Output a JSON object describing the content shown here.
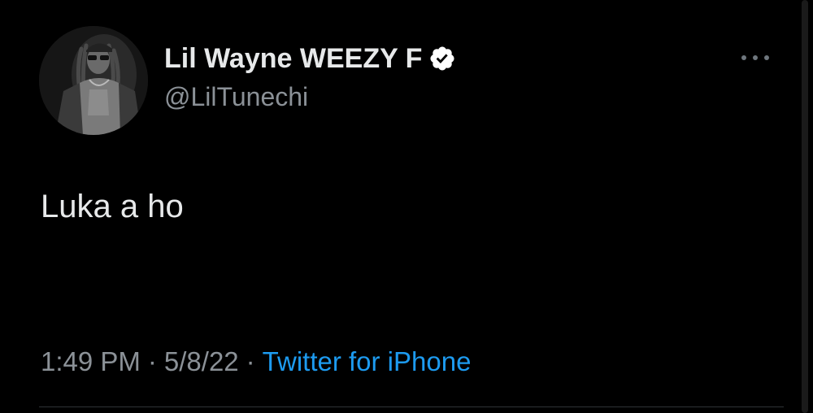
{
  "tweet": {
    "author": {
      "display_name": "Lil Wayne WEEZY F",
      "handle": "@LilTunechi",
      "verified": true,
      "avatar_icon": "profile-photo"
    },
    "text": "Luka a ho",
    "time": "1:49 PM",
    "date": "5/8/22",
    "separator": "·",
    "source": "Twitter for iPhone",
    "more_icon": "ellipsis-icon"
  },
  "colors": {
    "background": "#000000",
    "primary_text": "#e7e9ea",
    "secondary_text": "#8b9197",
    "link": "#1d9bf0",
    "divider": "#2f3336"
  }
}
